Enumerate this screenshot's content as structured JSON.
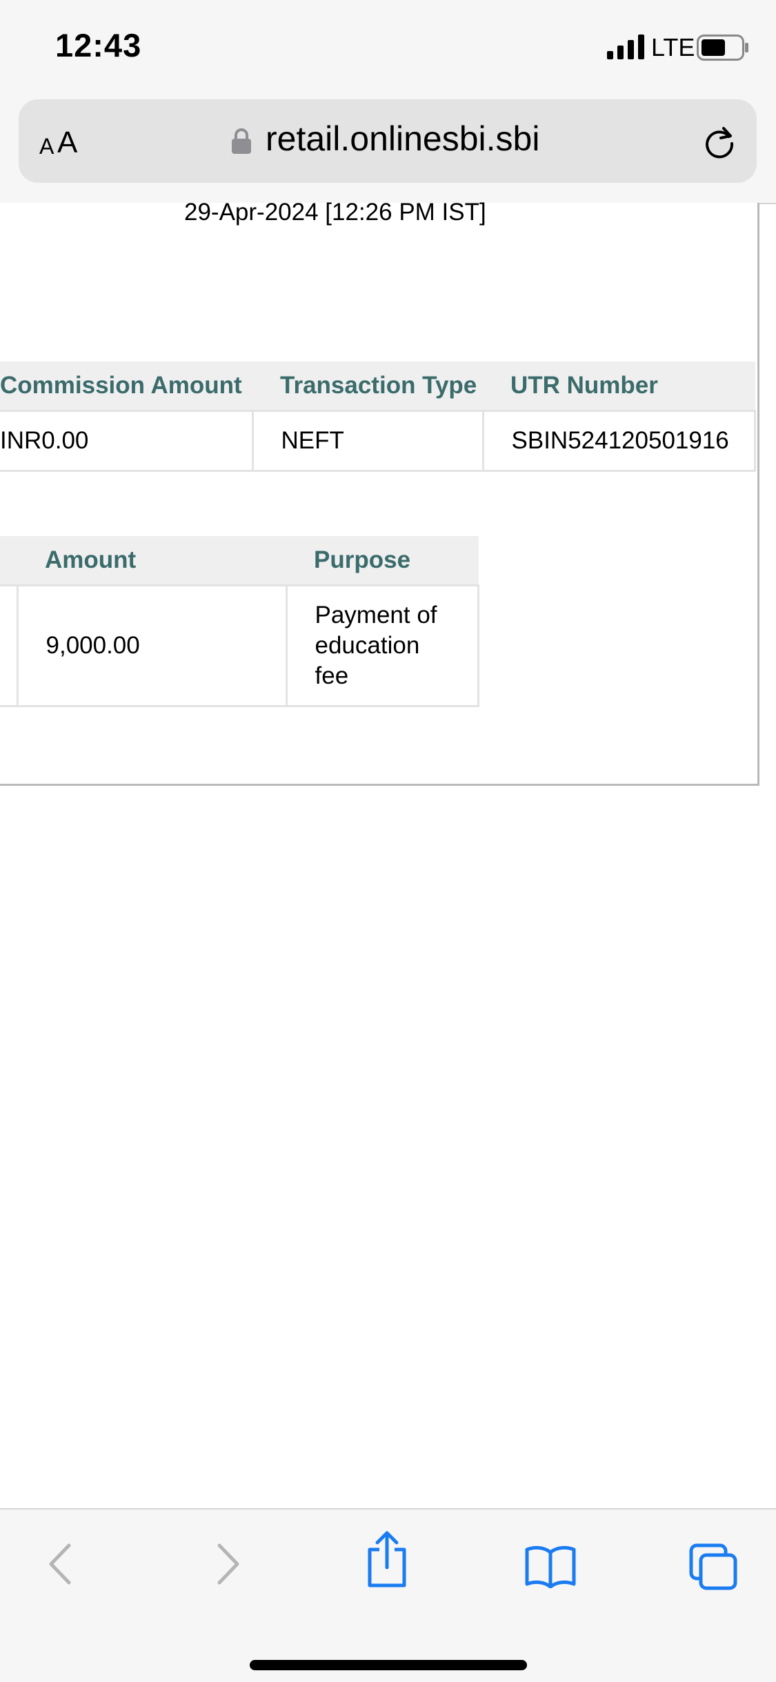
{
  "status_bar": {
    "time": "12:43",
    "network": "LTE",
    "signal_icon": "cellular-signal-icon",
    "battery_icon": "battery-icon"
  },
  "browser": {
    "text_size_small": "A",
    "text_size_large": "A",
    "url": "retail.onlinesbi.sbi",
    "secure_icon": "lock-icon",
    "reload_icon": "reload-icon"
  },
  "receipt": {
    "timestamp": "29-Apr-2024 [12:26 PM IST]",
    "transaction_table": {
      "headers": [
        "Commission Amount",
        "Transaction Type",
        "UTR Number"
      ],
      "row": [
        "INR0.00",
        "NEFT",
        "SBIN524120501916"
      ]
    },
    "amount_table": {
      "headers": [
        "",
        "Amount",
        "Purpose"
      ],
      "row": [
        "",
        "9,000.00",
        "Payment of education fee"
      ]
    }
  },
  "toolbar": {
    "icons": [
      "back-icon",
      "forward-icon",
      "share-icon",
      "bookmarks-icon",
      "tabs-icon"
    ]
  },
  "colors": {
    "header_text": "#3b6b6b",
    "header_bg": "#efefef",
    "ios_blue": "#1a7cf0",
    "disabled_gray": "#b5b5b5"
  }
}
